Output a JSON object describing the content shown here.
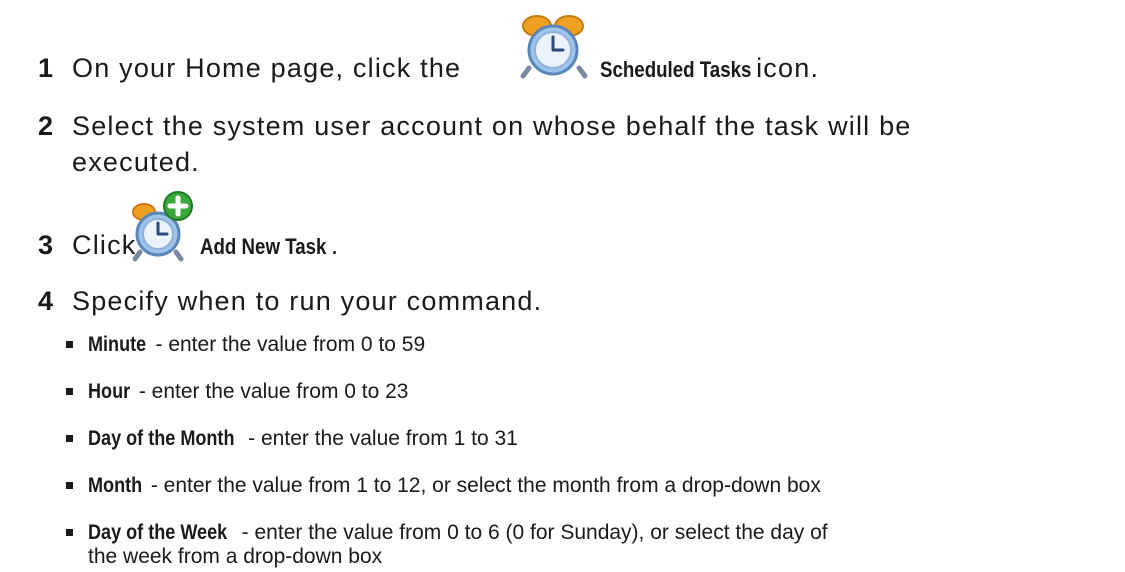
{
  "steps": [
    {
      "number": "1",
      "text_before": "On your Home page, click the",
      "ui_label": "Scheduled Tasks",
      "text_after": "icon.",
      "icon": "alarm-clock-icon"
    },
    {
      "number": "2",
      "line1": "Select the system user account on whose behalf the task will be",
      "line2": "executed."
    },
    {
      "number": "3",
      "text_before": "Click",
      "ui_label": "Add New Task",
      "text_after": ".",
      "icon": "alarm-clock-add-icon"
    },
    {
      "number": "4",
      "text": "Specify when to run your command."
    }
  ],
  "bullets": [
    {
      "term": "Minute",
      "desc": "- enter the value from 0 to 59"
    },
    {
      "term": "Hour",
      "desc": "- enter the value from 0 to 23"
    },
    {
      "term": "Day of the Month",
      "desc": "- enter the value from 1 to 31"
    },
    {
      "term": "Month",
      "desc": "- enter the value from 1 to 12, or select the month from a drop-down box"
    },
    {
      "term": "Day of the Week",
      "desc": "- enter the value from 0 to 6 (0 for Sunday), or select the day of",
      "desc_line2": "the week from a drop-down box"
    }
  ],
  "colors": {
    "text": "#1a1a1a",
    "clock_bell": "#f0a020",
    "clock_face": "#9ec4ec",
    "plus_badge": "#3aa83a"
  }
}
